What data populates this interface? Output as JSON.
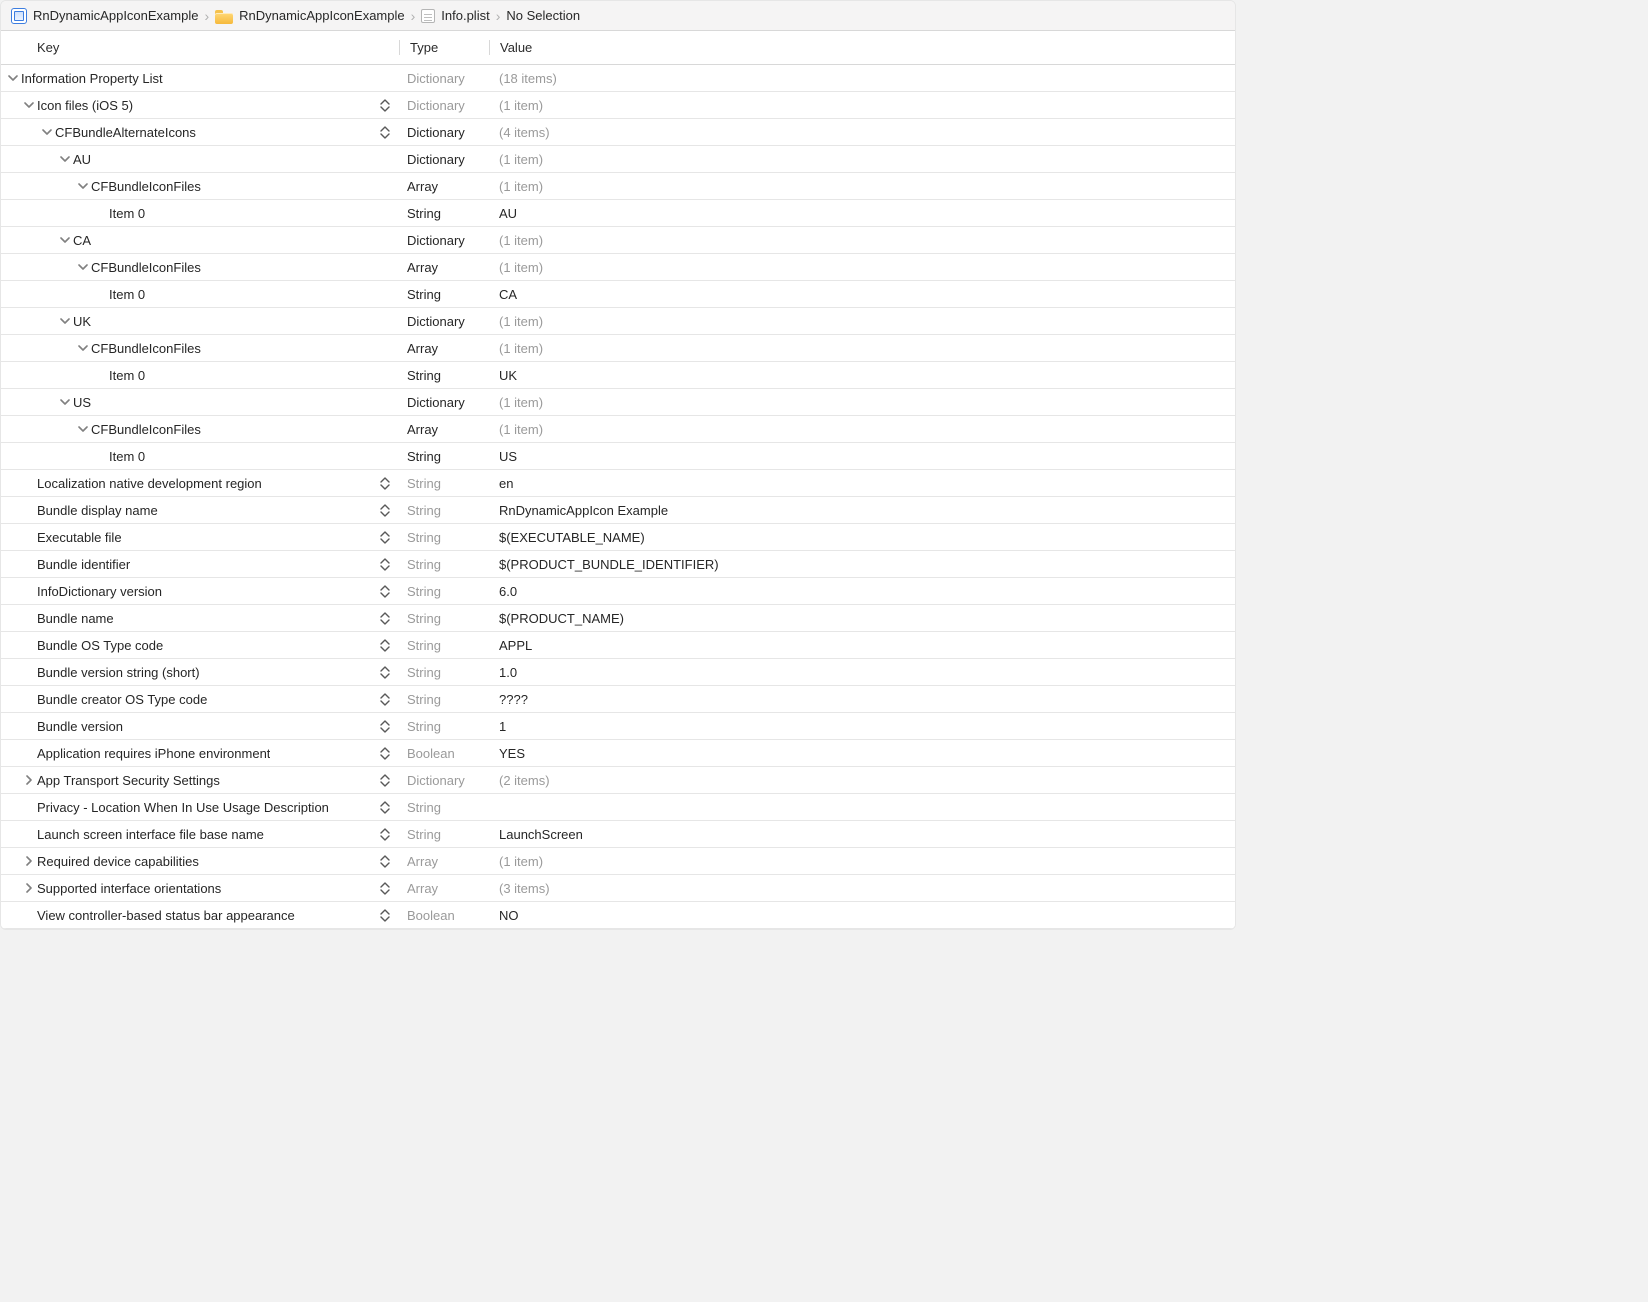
{
  "breadcrumbs": {
    "project": "RnDynamicAppIconExample",
    "folder": "RnDynamicAppIconExample",
    "file": "Info.plist",
    "selection": "No Selection"
  },
  "columns": {
    "key": "Key",
    "type": "Type",
    "value": "Value"
  },
  "rows": [
    {
      "indent": 0,
      "disclosure": "down",
      "stepper": false,
      "key": "Information Property List",
      "type": "Dictionary",
      "typeGray": true,
      "value": "(18 items)",
      "valueGray": true
    },
    {
      "indent": 1,
      "disclosure": "down",
      "stepper": true,
      "key": "Icon files (iOS 5)",
      "type": "Dictionary",
      "typeGray": true,
      "value": "(1 item)",
      "valueGray": true
    },
    {
      "indent": 2,
      "disclosure": "down",
      "stepper": true,
      "key": "CFBundleAlternateIcons",
      "type": "Dictionary",
      "typeGray": false,
      "value": "(4 items)",
      "valueGray": true
    },
    {
      "indent": 3,
      "disclosure": "down",
      "stepper": false,
      "key": "AU",
      "type": "Dictionary",
      "typeGray": false,
      "value": "(1 item)",
      "valueGray": true
    },
    {
      "indent": 4,
      "disclosure": "down",
      "stepper": false,
      "key": "CFBundleIconFiles",
      "type": "Array",
      "typeGray": false,
      "value": "(1 item)",
      "valueGray": true
    },
    {
      "indent": 5,
      "disclosure": "none",
      "stepper": false,
      "key": "Item 0",
      "type": "String",
      "typeGray": false,
      "value": "AU",
      "valueGray": false
    },
    {
      "indent": 3,
      "disclosure": "down",
      "stepper": false,
      "key": "CA",
      "type": "Dictionary",
      "typeGray": false,
      "value": "(1 item)",
      "valueGray": true
    },
    {
      "indent": 4,
      "disclosure": "down",
      "stepper": false,
      "key": "CFBundleIconFiles",
      "type": "Array",
      "typeGray": false,
      "value": "(1 item)",
      "valueGray": true
    },
    {
      "indent": 5,
      "disclosure": "none",
      "stepper": false,
      "key": "Item 0",
      "type": "String",
      "typeGray": false,
      "value": "CA",
      "valueGray": false
    },
    {
      "indent": 3,
      "disclosure": "down",
      "stepper": false,
      "key": "UK",
      "type": "Dictionary",
      "typeGray": false,
      "value": "(1 item)",
      "valueGray": true
    },
    {
      "indent": 4,
      "disclosure": "down",
      "stepper": false,
      "key": "CFBundleIconFiles",
      "type": "Array",
      "typeGray": false,
      "value": "(1 item)",
      "valueGray": true
    },
    {
      "indent": 5,
      "disclosure": "none",
      "stepper": false,
      "key": "Item 0",
      "type": "String",
      "typeGray": false,
      "value": "UK",
      "valueGray": false
    },
    {
      "indent": 3,
      "disclosure": "down",
      "stepper": false,
      "key": "US",
      "type": "Dictionary",
      "typeGray": false,
      "value": "(1 item)",
      "valueGray": true
    },
    {
      "indent": 4,
      "disclosure": "down",
      "stepper": false,
      "key": "CFBundleIconFiles",
      "type": "Array",
      "typeGray": false,
      "value": "(1 item)",
      "valueGray": true
    },
    {
      "indent": 5,
      "disclosure": "none",
      "stepper": false,
      "key": "Item 0",
      "type": "String",
      "typeGray": false,
      "value": "US",
      "valueGray": false
    },
    {
      "indent": 1,
      "disclosure": "none",
      "stepper": true,
      "key": "Localization native development region",
      "type": "String",
      "typeGray": true,
      "value": "en",
      "valueGray": false
    },
    {
      "indent": 1,
      "disclosure": "none",
      "stepper": true,
      "key": "Bundle display name",
      "type": "String",
      "typeGray": true,
      "value": "RnDynamicAppIcon Example",
      "valueGray": false
    },
    {
      "indent": 1,
      "disclosure": "none",
      "stepper": true,
      "key": "Executable file",
      "type": "String",
      "typeGray": true,
      "value": "$(EXECUTABLE_NAME)",
      "valueGray": false
    },
    {
      "indent": 1,
      "disclosure": "none",
      "stepper": true,
      "key": "Bundle identifier",
      "type": "String",
      "typeGray": true,
      "value": "$(PRODUCT_BUNDLE_IDENTIFIER)",
      "valueGray": false
    },
    {
      "indent": 1,
      "disclosure": "none",
      "stepper": true,
      "key": "InfoDictionary version",
      "type": "String",
      "typeGray": true,
      "value": "6.0",
      "valueGray": false
    },
    {
      "indent": 1,
      "disclosure": "none",
      "stepper": true,
      "key": "Bundle name",
      "type": "String",
      "typeGray": true,
      "value": "$(PRODUCT_NAME)",
      "valueGray": false
    },
    {
      "indent": 1,
      "disclosure": "none",
      "stepper": true,
      "key": "Bundle OS Type code",
      "type": "String",
      "typeGray": true,
      "value": "APPL",
      "valueGray": false
    },
    {
      "indent": 1,
      "disclosure": "none",
      "stepper": true,
      "key": "Bundle version string (short)",
      "type": "String",
      "typeGray": true,
      "value": "1.0",
      "valueGray": false
    },
    {
      "indent": 1,
      "disclosure": "none",
      "stepper": true,
      "key": "Bundle creator OS Type code",
      "type": "String",
      "typeGray": true,
      "value": "????",
      "valueGray": false
    },
    {
      "indent": 1,
      "disclosure": "none",
      "stepper": true,
      "key": "Bundle version",
      "type": "String",
      "typeGray": true,
      "value": "1",
      "valueGray": false
    },
    {
      "indent": 1,
      "disclosure": "none",
      "stepper": true,
      "key": "Application requires iPhone environment",
      "type": "Boolean",
      "typeGray": true,
      "value": "YES",
      "valueGray": false
    },
    {
      "indent": 1,
      "disclosure": "right",
      "stepper": true,
      "key": "App Transport Security Settings",
      "type": "Dictionary",
      "typeGray": true,
      "value": "(2 items)",
      "valueGray": true
    },
    {
      "indent": 1,
      "disclosure": "none",
      "stepper": true,
      "key": "Privacy - Location When In Use Usage Description",
      "type": "String",
      "typeGray": true,
      "value": "",
      "valueGray": false
    },
    {
      "indent": 1,
      "disclosure": "none",
      "stepper": true,
      "key": "Launch screen interface file base name",
      "type": "String",
      "typeGray": true,
      "value": "LaunchScreen",
      "valueGray": false
    },
    {
      "indent": 1,
      "disclosure": "right",
      "stepper": true,
      "key": "Required device capabilities",
      "type": "Array",
      "typeGray": true,
      "value": "(1 item)",
      "valueGray": true
    },
    {
      "indent": 1,
      "disclosure": "right",
      "stepper": true,
      "key": "Supported interface orientations",
      "type": "Array",
      "typeGray": true,
      "value": "(3 items)",
      "valueGray": true
    },
    {
      "indent": 1,
      "disclosure": "none",
      "stepper": true,
      "key": "View controller-based status bar appearance",
      "type": "Boolean",
      "typeGray": true,
      "value": "NO",
      "valueGray": false
    }
  ]
}
